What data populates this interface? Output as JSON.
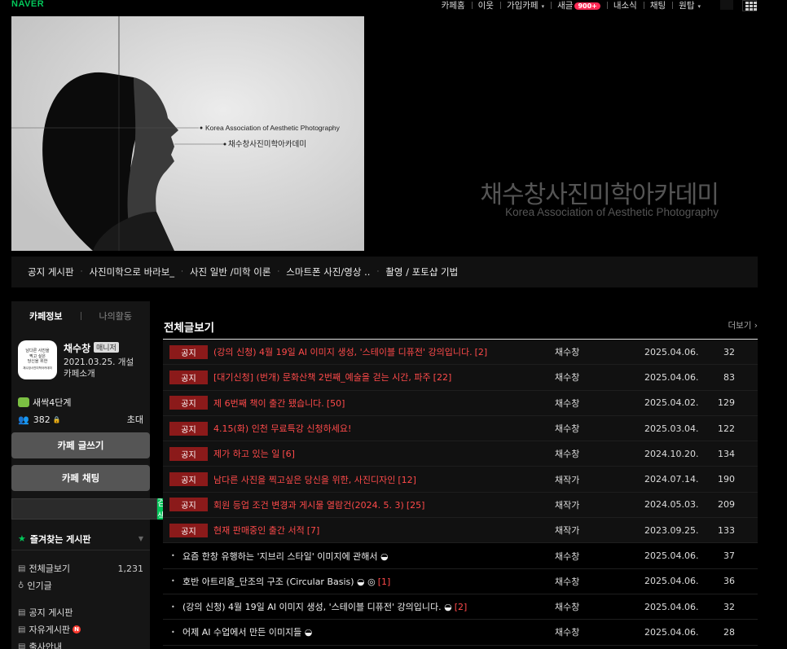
{
  "topbar": {
    "logo": "NAVER",
    "nav": [
      {
        "label": "카페홈"
      },
      {
        "label": "이웃"
      },
      {
        "label": "가입카페",
        "caret": "▾"
      },
      {
        "label": "새글",
        "badge": "900+"
      },
      {
        "label": "내소식"
      },
      {
        "label": "채팅"
      },
      {
        "label": "원탑",
        "caret": "▾"
      }
    ]
  },
  "banner": {
    "title": "채수창사진미학아카데미",
    "subtitle": "Korea Association of Aesthetic Photography",
    "img_label_en": "Korea Association of Aesthetic Photography",
    "img_label_ko": "채수창사진미학아카데미"
  },
  "menubar": {
    "items": [
      "공지 게시판",
      "사진미학으로 바라보_",
      "사진 일반 /미학 이론",
      "스마트폰 사진/영상 ..",
      "촬영 / 포토샵 기법"
    ],
    "separator": "·"
  },
  "sidebar": {
    "tab_info": "카페정보",
    "tab_activity": "나의활동",
    "profile_text": [
      "남다른 사진을",
      "찍고 싶은",
      "당신을 위한",
      "채수창사진미학아카데미"
    ],
    "manager_name": "채수창",
    "manager_tag": "매니저",
    "created": "2021.03.25. 개설",
    "intro": "카페소개",
    "level": "새싹4단계",
    "member_count": "382",
    "invite": "초대",
    "write_button": "카페 글쓰기",
    "chat_button": "카페 채팅",
    "search_button": "검색",
    "favorites_title": "즐겨찾는 게시판",
    "boards": [
      {
        "icon": "▤",
        "label": "전체글보기",
        "count": "1,231"
      },
      {
        "icon": "♁",
        "label": "인기글",
        "count": ""
      },
      {
        "icon": "▤",
        "label": "공지 게시판",
        "count": ""
      },
      {
        "icon": "▤",
        "label": "자유게시판",
        "count": "",
        "new": "N"
      },
      {
        "icon": "▤",
        "label": "출사안내",
        "count": ""
      }
    ]
  },
  "main": {
    "title": "전체글보기",
    "more": "더보기 ›",
    "notice_tag": "공지",
    "rows": [
      {
        "notice": true,
        "title": "(강의 신청) 4월 19일 AI 이미지 생성, '스테이블 디퓨전' 강의입니다.",
        "comments": "[2]",
        "author": "채수창",
        "date": "2025.04.06.",
        "views": "32"
      },
      {
        "notice": true,
        "title": "[대기신청] (번개) 문화산책 2번째_예술을 걷는 시간, 파주",
        "comments": "[22]",
        "author": "채수창",
        "date": "2025.04.06.",
        "views": "83"
      },
      {
        "notice": true,
        "title": "제 6번째 책이 출간 됐습니다.",
        "comments": "[50]",
        "author": "채수창",
        "date": "2025.04.02.",
        "views": "129"
      },
      {
        "notice": true,
        "title": "4.15(화) 인천 무료특강 신청하세요!",
        "comments": "",
        "author": "채수창",
        "date": "2025.03.04.",
        "views": "122"
      },
      {
        "notice": true,
        "title": "제가 하고 있는 일",
        "comments": "[6]",
        "author": "채수창",
        "date": "2024.10.20.",
        "views": "134"
      },
      {
        "notice": true,
        "title": "남다른 사진을 찍고싶은 당신을 위한, 사진디자인",
        "comments": "[12]",
        "author": "채작가",
        "date": "2024.07.14.",
        "views": "190"
      },
      {
        "notice": true,
        "title": "회원 등업 조건 변경과 게시물 열람건(2024. 5. 3)",
        "comments": "[25]",
        "author": "채작가",
        "date": "2024.05.03.",
        "views": "209"
      },
      {
        "notice": true,
        "title": "현재 판매중인 출간 서적",
        "comments": "[7]",
        "author": "채작가",
        "date": "2023.09.25.",
        "views": "133"
      },
      {
        "notice": false,
        "title": "요즘 한창 유행하는 '지브리 스타일' 이미지에 관해서 ◒",
        "comments": "",
        "author": "채수창",
        "date": "2025.04.06.",
        "views": "37"
      },
      {
        "notice": false,
        "title": "호반 아트리움_단조의 구조 (Circular Basis) ◒ ◎",
        "comments": "[1]",
        "author": "채수창",
        "date": "2025.04.06.",
        "views": "36"
      },
      {
        "notice": false,
        "title": "(강의 신청) 4월 19일 AI 이미지 생성, '스테이블 디퓨전' 강의입니다. ◒",
        "comments": "[2]",
        "author": "채수창",
        "date": "2025.04.06.",
        "views": "32"
      },
      {
        "notice": false,
        "title": "어제 AI 수업에서 만든 이미지들 ◒",
        "comments": "",
        "author": "채수창",
        "date": "2025.04.06.",
        "views": "28"
      }
    ]
  }
}
